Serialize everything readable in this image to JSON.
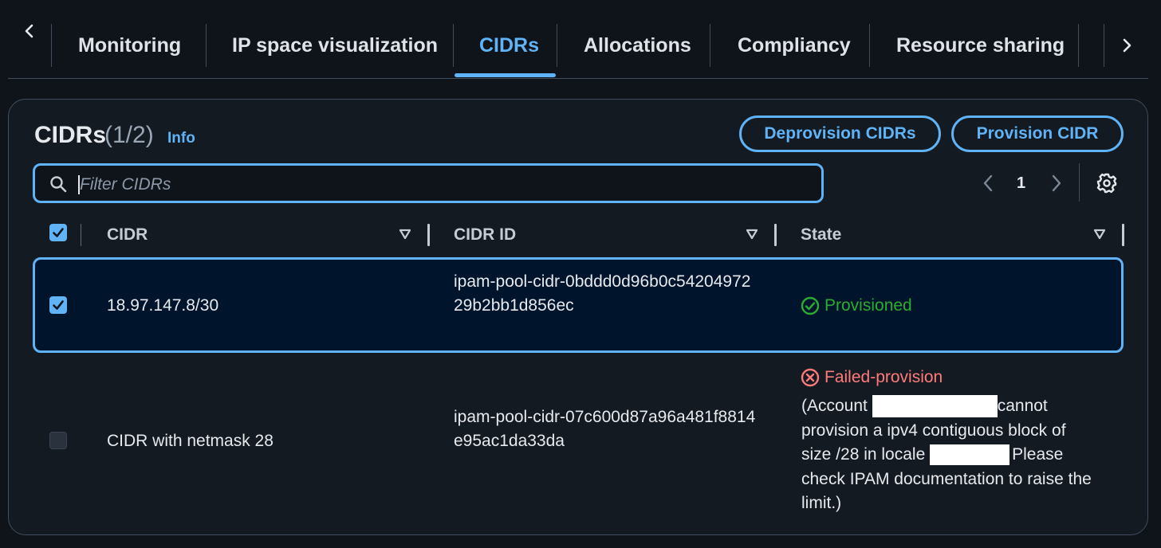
{
  "tabs": [
    {
      "label": "Monitoring",
      "active": false
    },
    {
      "label": "IP space visualization",
      "active": false
    },
    {
      "label": "CIDRs",
      "active": true
    },
    {
      "label": "Allocations",
      "active": false
    },
    {
      "label": "Compliancy",
      "active": false
    },
    {
      "label": "Resource sharing",
      "active": false
    }
  ],
  "header": {
    "title": "CIDRs",
    "count": "(1/2)",
    "info_label": "Info",
    "deprovision_label": "Deprovision CIDRs",
    "provision_label": "Provision CIDR"
  },
  "search": {
    "placeholder": "Filter CIDRs",
    "value": ""
  },
  "pagination": {
    "current_page": "1"
  },
  "columns": [
    "CIDR",
    "CIDR ID",
    "State"
  ],
  "rows": [
    {
      "selected": true,
      "cidr": "18.97.147.8/30",
      "cidr_id": "ipam-pool-cidr-0bddd0d96b0c5420497229b2bb1d856ec",
      "state": "Provisioned",
      "state_type": "success"
    },
    {
      "selected": false,
      "cidr": "CIDR with netmask 28",
      "cidr_id": "ipam-pool-cidr-07c600d87a96a481f8814e95ac1da33da",
      "state": "Failed-provision",
      "state_type": "error",
      "reason_parts": [
        "(Account ",
        "cannot provision a ipv4 contiguous block of size /28 in locale ",
        "Please check IPAM documentation to raise the limit.)"
      ]
    }
  ],
  "colors": {
    "accent": "#5fb3f6",
    "success": "#29ad32",
    "error": "#ff7a7a",
    "background": "#0f141a",
    "selected_row": "#00142b"
  },
  "icons": [
    "chevron-left-icon",
    "chevron-right-icon",
    "search-icon",
    "settings-gear-icon",
    "filter-triangle-icon",
    "check-circle-icon",
    "error-circle-icon",
    "checkbox-check-icon"
  ]
}
